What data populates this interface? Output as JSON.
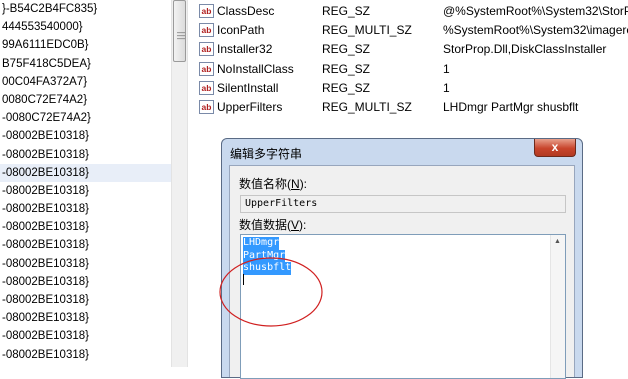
{
  "tree": {
    "items": [
      "}-B54C2B4FC835}",
      "444553540000}",
      "99A6111EDC0B}",
      "B75F418C5DEA}",
      "00C04FA372A7}",
      "0080C72E74A2}",
      "-0080C72E74A2}",
      "-08002BE10318}",
      "-08002BE10318}",
      "-08002BE10318}",
      "-08002BE10318}",
      "-08002BE10318}",
      "-08002BE10318}",
      "-08002BE10318}",
      "-08002BE10318}",
      "-08002BE10318}",
      "-08002BE10318}",
      "-08002BE10318}",
      "-08002BE10318}",
      "-08002BE10318}",
      "-08002BE10318}"
    ]
  },
  "values": {
    "rows": [
      {
        "icon": "ab",
        "name": "ClassDesc",
        "type": "REG_SZ",
        "data": "@%SystemRoot%\\System32\\StorPr"
      },
      {
        "icon": "ab",
        "name": "IconPath",
        "type": "REG_MULTI_SZ",
        "data": "%SystemRoot%\\System32\\imagere"
      },
      {
        "icon": "ab",
        "name": "Installer32",
        "type": "REG_SZ",
        "data": "StorProp.Dll,DiskClassInstaller"
      },
      {
        "icon": "ab",
        "name": "NoInstallClass",
        "type": "REG_SZ",
        "data": "1"
      },
      {
        "icon": "ab",
        "name": "SilentInstall",
        "type": "REG_SZ",
        "data": "1"
      },
      {
        "icon": "ab",
        "name": "UpperFilters",
        "type": "REG_MULTI_SZ",
        "data": "LHDmgr PartMgr shusbflt"
      }
    ]
  },
  "dialog": {
    "title": "编辑多字符串",
    "close": "x",
    "name_label": "数值名称",
    "name_key": "N",
    "name_value": "UpperFilters",
    "data_label": "数值数据",
    "data_key": "V",
    "data_lines": [
      "LHDmgr",
      "PartMgr",
      "shusbflt"
    ]
  },
  "colors": {
    "selection": "#3399ff",
    "annotation": "#d02020",
    "dialog_frame": "#c9d9ee"
  }
}
